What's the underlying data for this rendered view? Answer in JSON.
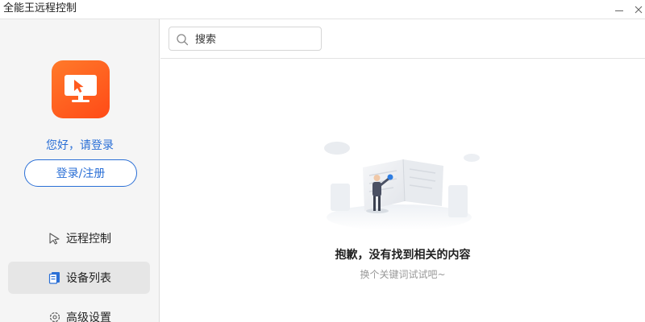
{
  "window": {
    "title": "全能王远程控制"
  },
  "sidebar": {
    "logo_icon": "monitor-cursor-icon",
    "greeting": "您好，请登录",
    "login_button": "登录/注册",
    "items": [
      {
        "label": "远程控制",
        "icon": "remote-control-icon",
        "active": false
      },
      {
        "label": "设备列表",
        "icon": "device-list-icon",
        "active": true
      },
      {
        "label": "高级设置",
        "icon": "gear-icon",
        "active": false
      }
    ]
  },
  "search": {
    "placeholder": "搜索"
  },
  "empty_state": {
    "title": "抱歉，没有找到相关的内容",
    "hint": "换个关键词试试吧~"
  },
  "colors": {
    "accent": "#2a6fd6",
    "logo_orange": "#ff5a1f",
    "sidebar_bg": "#f5f5f5",
    "active_item_bg": "#e6e6e6"
  }
}
